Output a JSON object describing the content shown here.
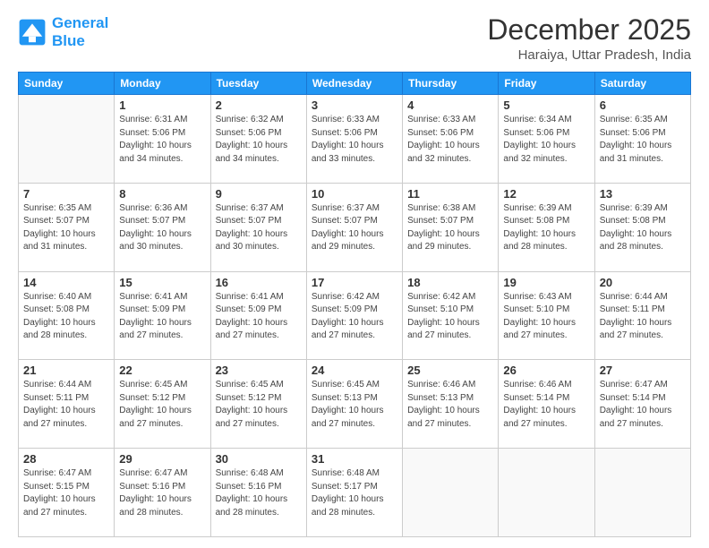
{
  "header": {
    "logo_line1": "General",
    "logo_line2": "Blue",
    "month_title": "December 2025",
    "location": "Haraiya, Uttar Pradesh, India"
  },
  "weekdays": [
    "Sunday",
    "Monday",
    "Tuesday",
    "Wednesday",
    "Thursday",
    "Friday",
    "Saturday"
  ],
  "weeks": [
    [
      {
        "day": "",
        "info": ""
      },
      {
        "day": "1",
        "info": "Sunrise: 6:31 AM\nSunset: 5:06 PM\nDaylight: 10 hours\nand 34 minutes."
      },
      {
        "day": "2",
        "info": "Sunrise: 6:32 AM\nSunset: 5:06 PM\nDaylight: 10 hours\nand 34 minutes."
      },
      {
        "day": "3",
        "info": "Sunrise: 6:33 AM\nSunset: 5:06 PM\nDaylight: 10 hours\nand 33 minutes."
      },
      {
        "day": "4",
        "info": "Sunrise: 6:33 AM\nSunset: 5:06 PM\nDaylight: 10 hours\nand 32 minutes."
      },
      {
        "day": "5",
        "info": "Sunrise: 6:34 AM\nSunset: 5:06 PM\nDaylight: 10 hours\nand 32 minutes."
      },
      {
        "day": "6",
        "info": "Sunrise: 6:35 AM\nSunset: 5:06 PM\nDaylight: 10 hours\nand 31 minutes."
      }
    ],
    [
      {
        "day": "7",
        "info": "Sunrise: 6:35 AM\nSunset: 5:07 PM\nDaylight: 10 hours\nand 31 minutes."
      },
      {
        "day": "8",
        "info": "Sunrise: 6:36 AM\nSunset: 5:07 PM\nDaylight: 10 hours\nand 30 minutes."
      },
      {
        "day": "9",
        "info": "Sunrise: 6:37 AM\nSunset: 5:07 PM\nDaylight: 10 hours\nand 30 minutes."
      },
      {
        "day": "10",
        "info": "Sunrise: 6:37 AM\nSunset: 5:07 PM\nDaylight: 10 hours\nand 29 minutes."
      },
      {
        "day": "11",
        "info": "Sunrise: 6:38 AM\nSunset: 5:07 PM\nDaylight: 10 hours\nand 29 minutes."
      },
      {
        "day": "12",
        "info": "Sunrise: 6:39 AM\nSunset: 5:08 PM\nDaylight: 10 hours\nand 28 minutes."
      },
      {
        "day": "13",
        "info": "Sunrise: 6:39 AM\nSunset: 5:08 PM\nDaylight: 10 hours\nand 28 minutes."
      }
    ],
    [
      {
        "day": "14",
        "info": "Sunrise: 6:40 AM\nSunset: 5:08 PM\nDaylight: 10 hours\nand 28 minutes."
      },
      {
        "day": "15",
        "info": "Sunrise: 6:41 AM\nSunset: 5:09 PM\nDaylight: 10 hours\nand 27 minutes."
      },
      {
        "day": "16",
        "info": "Sunrise: 6:41 AM\nSunset: 5:09 PM\nDaylight: 10 hours\nand 27 minutes."
      },
      {
        "day": "17",
        "info": "Sunrise: 6:42 AM\nSunset: 5:09 PM\nDaylight: 10 hours\nand 27 minutes."
      },
      {
        "day": "18",
        "info": "Sunrise: 6:42 AM\nSunset: 5:10 PM\nDaylight: 10 hours\nand 27 minutes."
      },
      {
        "day": "19",
        "info": "Sunrise: 6:43 AM\nSunset: 5:10 PM\nDaylight: 10 hours\nand 27 minutes."
      },
      {
        "day": "20",
        "info": "Sunrise: 6:44 AM\nSunset: 5:11 PM\nDaylight: 10 hours\nand 27 minutes."
      }
    ],
    [
      {
        "day": "21",
        "info": "Sunrise: 6:44 AM\nSunset: 5:11 PM\nDaylight: 10 hours\nand 27 minutes."
      },
      {
        "day": "22",
        "info": "Sunrise: 6:45 AM\nSunset: 5:12 PM\nDaylight: 10 hours\nand 27 minutes."
      },
      {
        "day": "23",
        "info": "Sunrise: 6:45 AM\nSunset: 5:12 PM\nDaylight: 10 hours\nand 27 minutes."
      },
      {
        "day": "24",
        "info": "Sunrise: 6:45 AM\nSunset: 5:13 PM\nDaylight: 10 hours\nand 27 minutes."
      },
      {
        "day": "25",
        "info": "Sunrise: 6:46 AM\nSunset: 5:13 PM\nDaylight: 10 hours\nand 27 minutes."
      },
      {
        "day": "26",
        "info": "Sunrise: 6:46 AM\nSunset: 5:14 PM\nDaylight: 10 hours\nand 27 minutes."
      },
      {
        "day": "27",
        "info": "Sunrise: 6:47 AM\nSunset: 5:14 PM\nDaylight: 10 hours\nand 27 minutes."
      }
    ],
    [
      {
        "day": "28",
        "info": "Sunrise: 6:47 AM\nSunset: 5:15 PM\nDaylight: 10 hours\nand 27 minutes."
      },
      {
        "day": "29",
        "info": "Sunrise: 6:47 AM\nSunset: 5:16 PM\nDaylight: 10 hours\nand 28 minutes."
      },
      {
        "day": "30",
        "info": "Sunrise: 6:48 AM\nSunset: 5:16 PM\nDaylight: 10 hours\nand 28 minutes."
      },
      {
        "day": "31",
        "info": "Sunrise: 6:48 AM\nSunset: 5:17 PM\nDaylight: 10 hours\nand 28 minutes."
      },
      {
        "day": "",
        "info": ""
      },
      {
        "day": "",
        "info": ""
      },
      {
        "day": "",
        "info": ""
      }
    ]
  ]
}
